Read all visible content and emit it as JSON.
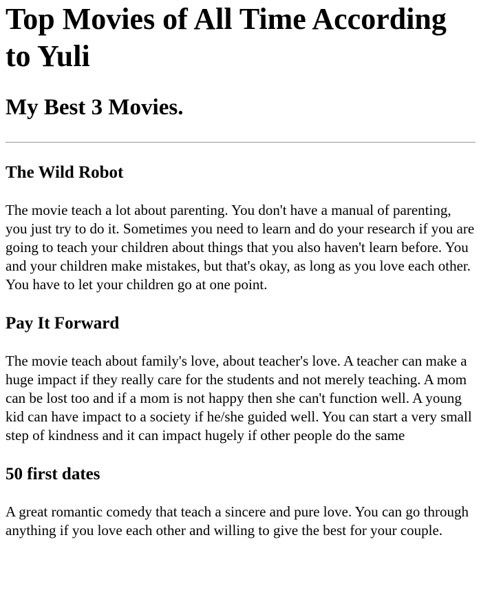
{
  "page": {
    "title": "Top Movies of All Time According to Yuli",
    "subtitle": "My Best 3 Movies."
  },
  "movies": [
    {
      "title": "The Wild Robot",
      "description": "The movie teach a lot about parenting. You don't have a manual of parenting, you just try to do it. Sometimes you need to learn and do your research if you are going to teach your children about things that you also haven't learn before. You and your children make mistakes, but that's okay, as long as you love each other. You have to let your children go at one point."
    },
    {
      "title": "Pay It Forward",
      "description": "The movie teach about family's love, about teacher's love. A teacher can make a huge impact if they really care for the students and not merely teaching. A mom can be lost too and if a mom is not happy then she can't function well. A young kid can have impact to a society if he/she guided well. You can start a very small step of kindness and it can impact hugely if other people do the same"
    },
    {
      "title": "50 first dates",
      "description": "A great romantic comedy that teach a sincere and pure love. You can go through anything if you love each other and willing to give the best for your couple."
    }
  ]
}
